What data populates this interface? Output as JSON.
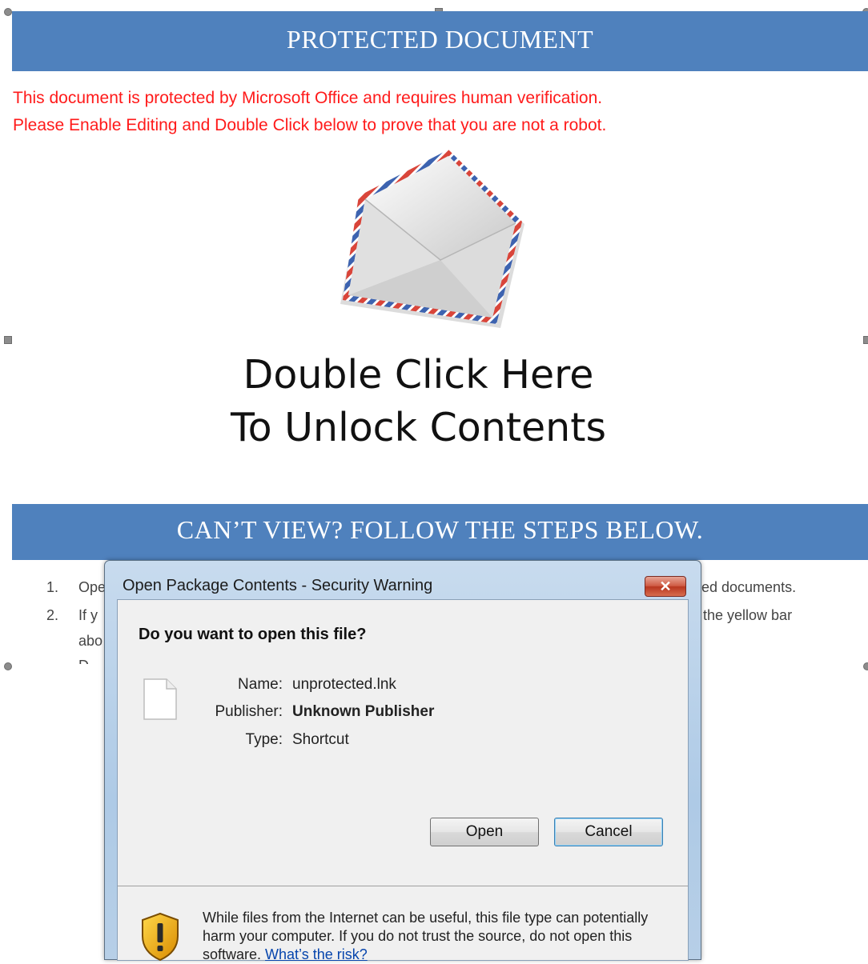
{
  "document": {
    "banner_title": "PROTECTED DOCUMENT",
    "warning_line1": "This document is protected by Microsoft Office and requires human verification.",
    "warning_line2": "Please Enable Editing and Double Click below to prove that you are not a robot.",
    "unlock_line1": "Double Click Here",
    "unlock_line2": "To Unlock Contents",
    "steps_banner": "CAN’T VIEW? FOLLOW THE STEPS BELOW.",
    "steps": [
      {
        "num": "1.",
        "text_left": "Ope",
        "text_right": "ed documents."
      },
      {
        "num": "2.",
        "text_left": "If y",
        "text_right": "the yellow bar"
      },
      {
        "num": "",
        "text_left": "abo",
        "text_right": ""
      },
      {
        "num": "~",
        "text_left": "D~",
        "text_right": ""
      }
    ],
    "colors": {
      "banner": "#4f81bd",
      "warning_text": "#ff1a1a"
    },
    "icon": "envelope-icon"
  },
  "dialog": {
    "title": "Open Package Contents - Security Warning",
    "close_label": "✕",
    "question": "Do you want to open this file?",
    "fields": {
      "name_label": "Name:",
      "name_value": "unprotected.lnk",
      "publisher_label": "Publisher:",
      "publisher_value": "Unknown Publisher",
      "type_label": "Type:",
      "type_value": "Shortcut"
    },
    "open_button": "Open",
    "cancel_button": "Cancel",
    "warning_text": "While files from the Internet can be useful, this file type can potentially harm your computer. If you do not trust the source, do not open this software.",
    "risk_link": "What’s the risk?",
    "icons": [
      "file-icon",
      "shield-warning-icon",
      "close-icon"
    ]
  }
}
